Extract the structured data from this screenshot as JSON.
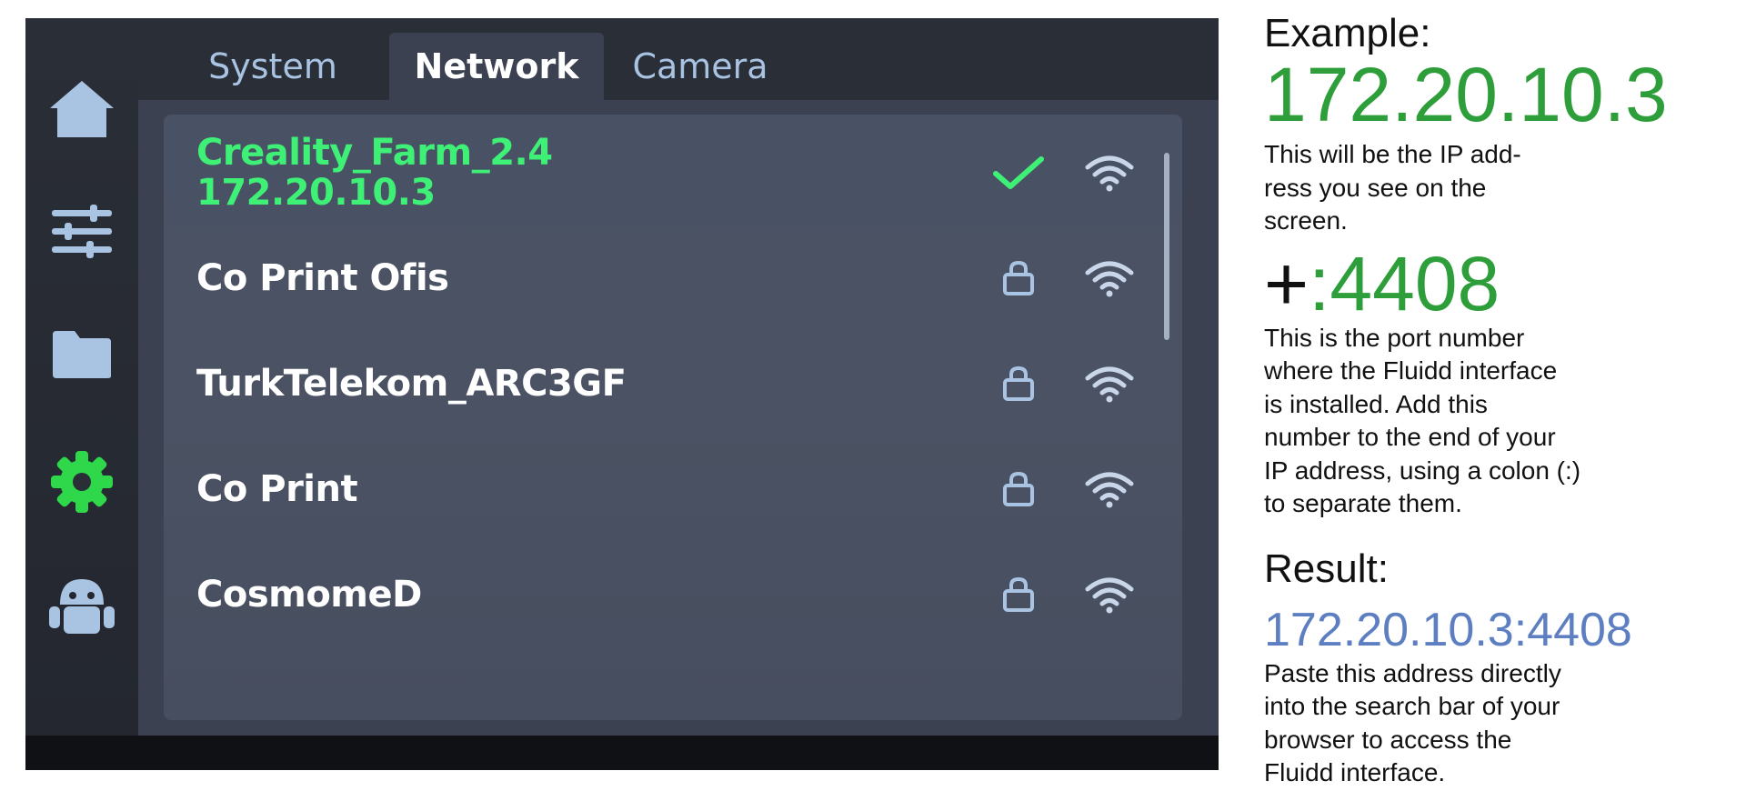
{
  "sidebar": {
    "items": [
      {
        "icon": "home-icon"
      },
      {
        "icon": "sliders-icon"
      },
      {
        "icon": "folder-icon"
      },
      {
        "icon": "gear-icon",
        "active": true
      },
      {
        "icon": "robot-icon"
      }
    ]
  },
  "tabs": [
    {
      "label": "System"
    },
    {
      "label": "Network",
      "active": true
    },
    {
      "label": "Camera"
    }
  ],
  "networks": [
    {
      "ssid": "Creality_Farm_2.4",
      "ip": "172.20.10.3",
      "status": "connected",
      "status_icon": "checkmark-icon",
      "wifi_icon": "wifi-icon"
    },
    {
      "ssid": "Co Print Ofis",
      "status": "locked",
      "status_icon": "lock-icon",
      "wifi_icon": "wifi-icon"
    },
    {
      "ssid": "TurkTelekom_ARC3GF",
      "status": "locked",
      "status_icon": "lock-icon",
      "wifi_icon": "wifi-icon"
    },
    {
      "ssid": "Co Print",
      "status": "locked",
      "status_icon": "lock-icon",
      "wifi_icon": "wifi-icon"
    },
    {
      "ssid": "CosmomeD",
      "status": "locked",
      "status_icon": "lock-icon",
      "wifi_icon": "wifi-icon"
    }
  ],
  "guide": {
    "example_heading": "Example:",
    "example_ip": "172.20.10.3",
    "example_desc_lines": [
      "This will be the IP add-",
      "ress you see on the",
      "screen."
    ],
    "port_plus": "+",
    "port": ":4408",
    "port_desc_lines": [
      "This is the port number",
      "where the Fluidd interface",
      "is installed. Add this",
      "number to the end of your",
      "IP address, using a colon (:)",
      "to separate them."
    ],
    "result_heading": "Result:",
    "result_address": "172.20.10.3:4408",
    "result_desc_lines": [
      "Paste this address directly",
      "into the search bar of your",
      "browser to access the",
      "Fluidd interface."
    ]
  },
  "colors": {
    "connected_green": "#3ff077",
    "guide_green": "#2e9e3b",
    "result_blue": "#5d7fc1",
    "icon_blue": "#a9c3e3",
    "active_gear_green": "#2fd84a"
  }
}
